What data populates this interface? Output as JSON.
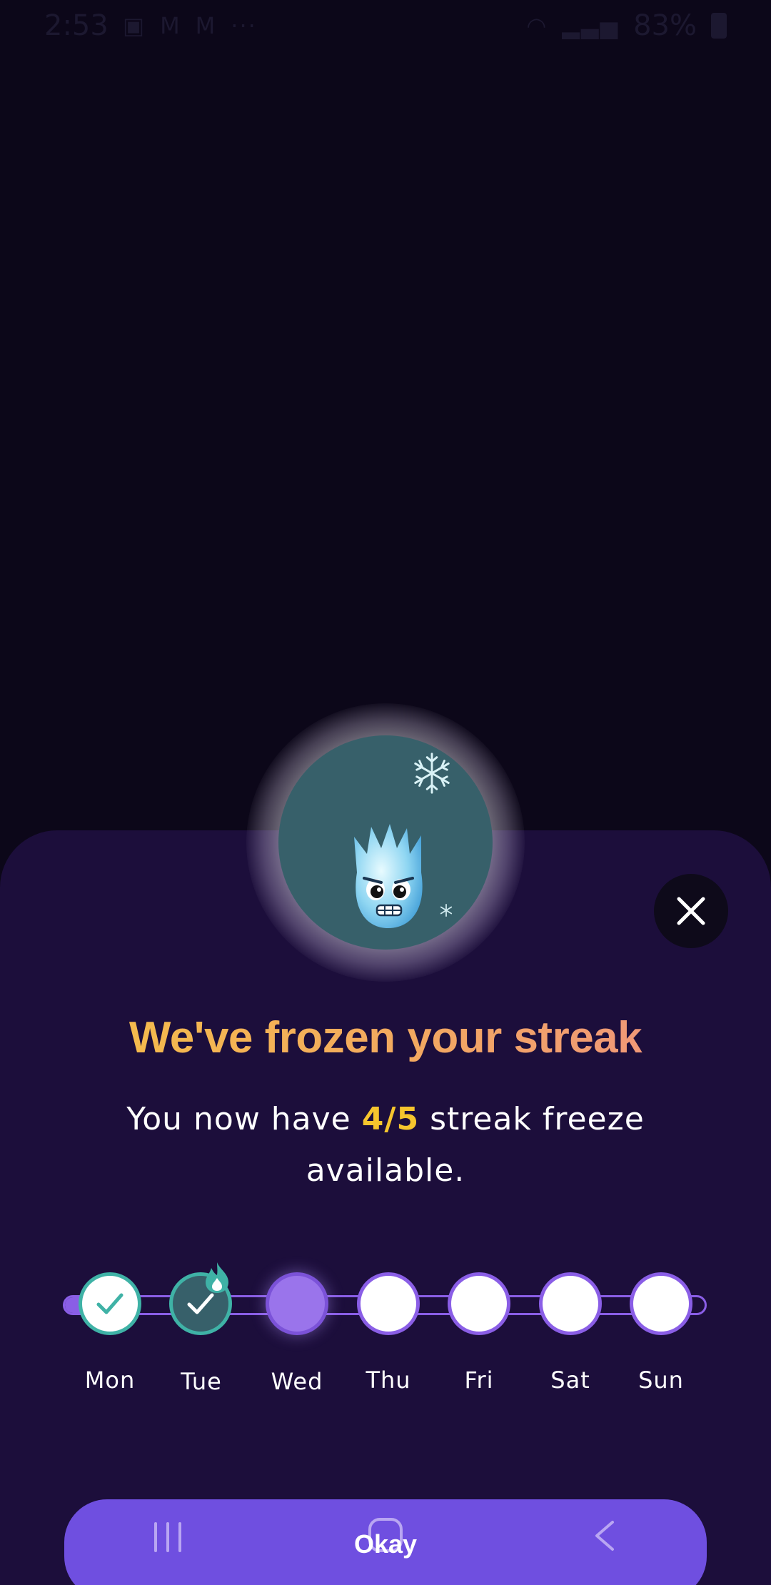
{
  "status_bar": {
    "time": "2:53",
    "app_icons": [
      "teams-icon",
      "gmail-icon",
      "gmail-icon"
    ],
    "more": "···",
    "battery": "83%"
  },
  "dialog": {
    "headline": "We've frozen your streak",
    "subtitle_before": "You now have",
    "freeze_count": "4/5",
    "subtitle_after": "streak freeze available.",
    "close_icon": "close-icon",
    "mascot": "frozen-flame-mascot"
  },
  "week": {
    "days": [
      {
        "label": "Mon",
        "state": "completed"
      },
      {
        "label": "Tue",
        "state": "completed-with-flame"
      },
      {
        "label": "Wed",
        "state": "frozen-today"
      },
      {
        "label": "Thu",
        "state": "upcoming"
      },
      {
        "label": "Fri",
        "state": "upcoming"
      },
      {
        "label": "Sat",
        "state": "upcoming"
      },
      {
        "label": "Sun",
        "state": "upcoming"
      }
    ]
  },
  "okay_button": {
    "label": "Okay"
  },
  "colors": {
    "background": "#0c0719",
    "sheet": "#1c0e3b",
    "accent": "#6f4fe0",
    "highlight": "#f6c52d",
    "teal": "#3fb2a6"
  }
}
